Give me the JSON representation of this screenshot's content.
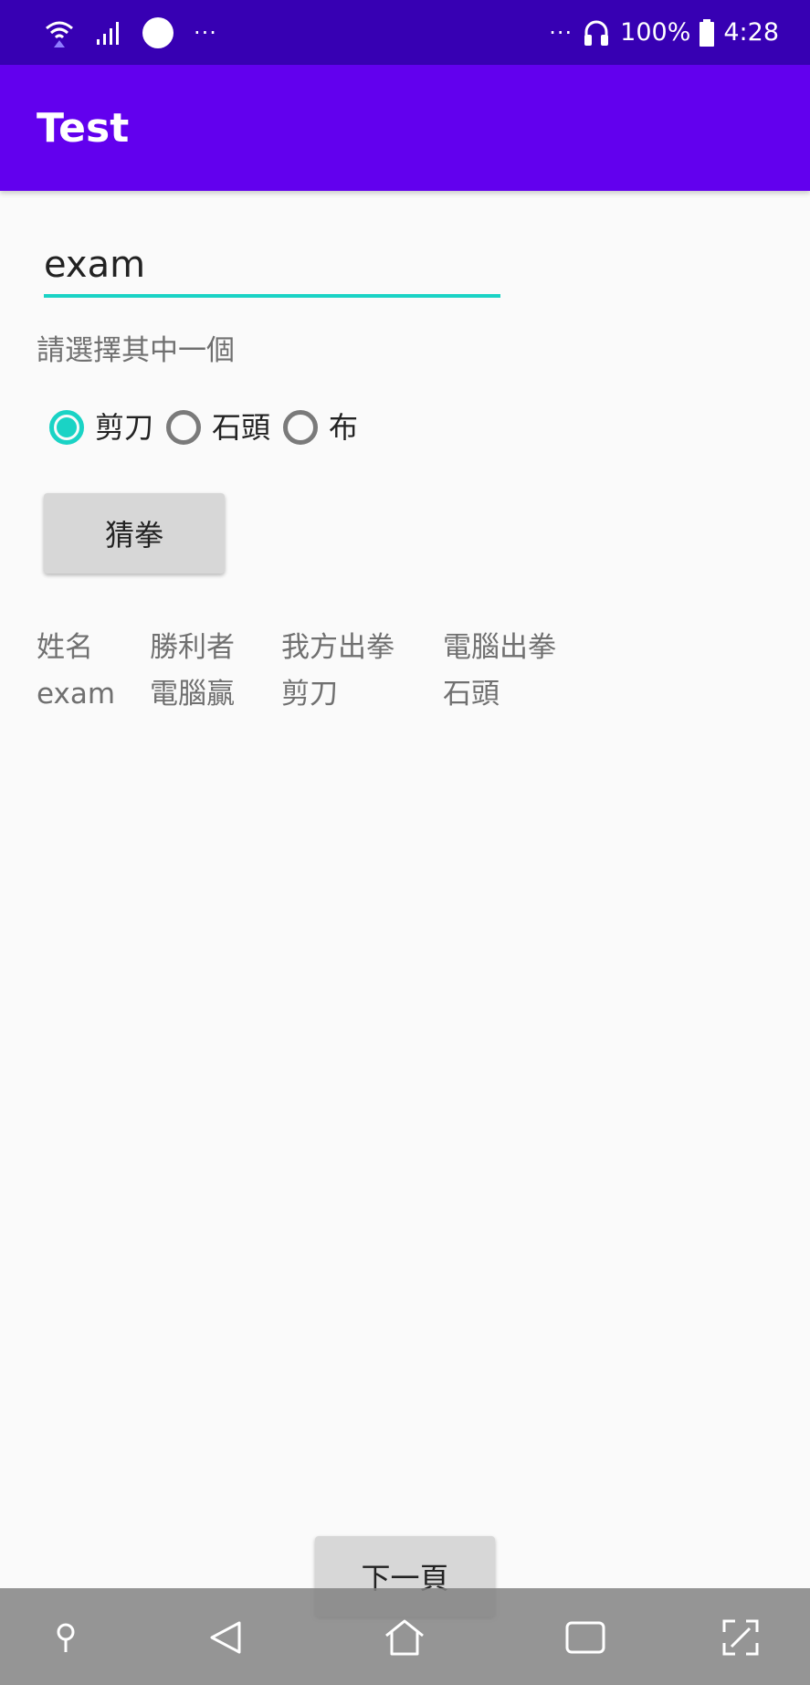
{
  "status_bar": {
    "left_dots": "···",
    "right_dots": "···",
    "battery_text": "100%",
    "time": "4:28"
  },
  "app_bar": {
    "title": "Test"
  },
  "form": {
    "name_value": "exam",
    "prompt": "請選擇其中一個",
    "options": [
      {
        "label": "剪刀",
        "checked": true
      },
      {
        "label": "石頭",
        "checked": false
      },
      {
        "label": "布",
        "checked": false
      }
    ],
    "guess_button": "猜拳"
  },
  "results": {
    "columns": [
      {
        "header": "姓名",
        "value": "exam"
      },
      {
        "header": "勝利者",
        "value": "電腦贏"
      },
      {
        "header": "我方出拳",
        "value": "剪刀"
      },
      {
        "header": "電腦出拳",
        "value": "石頭"
      }
    ]
  },
  "next_button": "下一頁",
  "colors": {
    "status_bar": "#3700b3",
    "app_bar": "#6200ee",
    "accent": "#1ad3c5"
  },
  "icons": {
    "status": [
      "wifi-icon",
      "signal-icon",
      "circle-icon",
      "headphones-icon",
      "battery-icon"
    ],
    "nav": [
      "pin-icon",
      "back-icon",
      "home-icon",
      "recents-icon",
      "expand-icon"
    ]
  }
}
